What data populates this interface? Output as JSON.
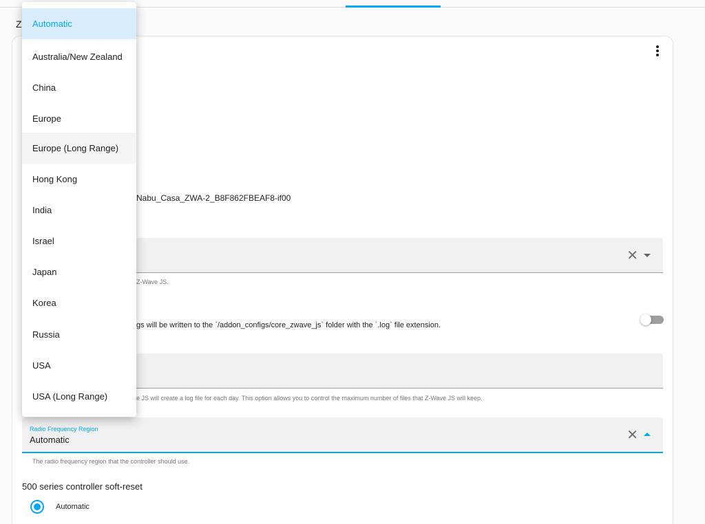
{
  "header": {
    "section_title": "Z"
  },
  "device": {
    "path": "Nabu_Casa_ZWA-2_B8F862FBEAF8-if00"
  },
  "field_1": {
    "helper": "Z-Wave JS."
  },
  "log_to_file": {
    "description": "gs will be written to the `/addon_configs/core_zwave_js` folder with the `.log` file extension.",
    "enabled": false
  },
  "field_2": {
    "helper": "e JS will create a log file for each day. This option allows you to control the maximum number of files that Z-Wave JS will keep."
  },
  "rf_region": {
    "label": "Radio Frequency Region",
    "value": "Automatic",
    "helper": "The radio frequency region that the controller should use.",
    "options": [
      "Automatic",
      "Australia/New Zealand",
      "China",
      "Europe",
      "Europe (Long Range)",
      "Hong Kong",
      "India",
      "Israel",
      "Japan",
      "Korea",
      "Russia",
      "USA",
      "USA (Long Range)"
    ],
    "selected_option": "Automatic",
    "hovered_option": "Europe (Long Range)"
  },
  "soft_reset": {
    "title": "500 series controller soft-reset",
    "option_label": "Automatic"
  },
  "icons": {
    "menu": "kebab-menu-icon",
    "clear": "close-icon",
    "dropdown": "caret-icon"
  },
  "colors": {
    "accent": "#03a9f4",
    "selected_bg": "#d8ecfb"
  }
}
